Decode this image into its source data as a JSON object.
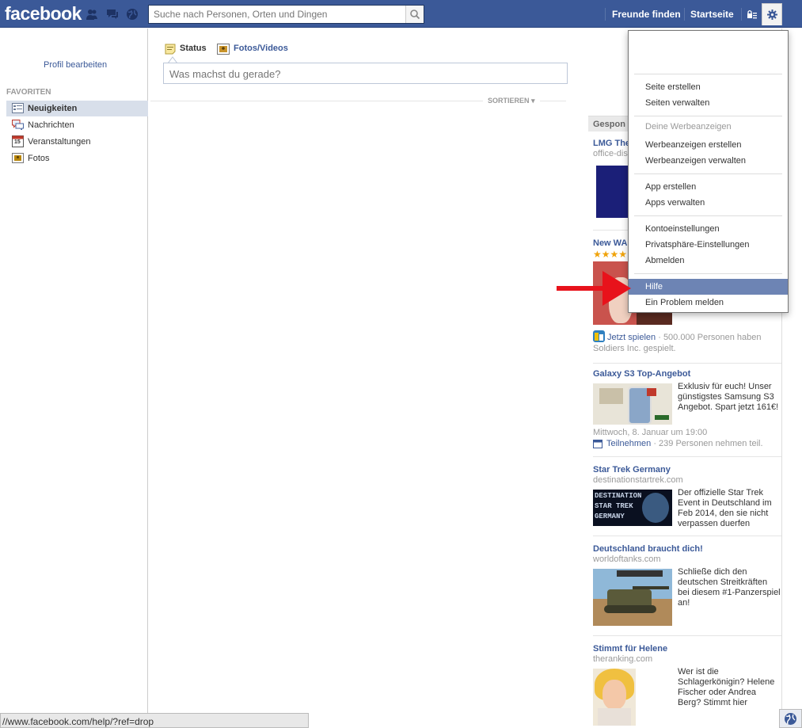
{
  "topbar": {
    "logo": "facebook",
    "search_placeholder": "Suche nach Personen, Orten und Dingen",
    "find_friends": "Freunde finden",
    "home": "Startseite"
  },
  "leftnav": {
    "profile_edit": "Profil bearbeiten",
    "favorites_header": "FAVORITEN",
    "items": [
      {
        "label": "Neuigkeiten",
        "icon": "news-feed-icon"
      },
      {
        "label": "Nachrichten",
        "icon": "messages-icon"
      },
      {
        "label": "Veranstaltungen",
        "icon": "calendar-icon",
        "badge": "15"
      },
      {
        "label": "Fotos",
        "icon": "photos-icon"
      }
    ]
  },
  "composer": {
    "tab_status": "Status",
    "tab_photos": "Fotos/Videos",
    "placeholder": "Was machst du gerade?",
    "sort_label": "SORTIEREN"
  },
  "dropdown": {
    "items": [
      {
        "label": "Seite erstellen"
      },
      {
        "label": "Seiten verwalten"
      },
      {
        "label": "Deine Werbeanzeigen"
      },
      {
        "label": "Werbeanzeigen erstellen"
      },
      {
        "label": "Werbeanzeigen verwalten"
      },
      {
        "label": "App erstellen"
      },
      {
        "label": "Apps verwalten"
      },
      {
        "label": "Kontoeinstellungen"
      },
      {
        "label": "Privatsphäre-Einstellungen"
      },
      {
        "label": "Abmelden"
      },
      {
        "label": "Hilfe"
      },
      {
        "label": "Ein Problem melden"
      }
    ]
  },
  "rightcol": {
    "sponsored": "Gespon",
    "ads": [
      {
        "title": "LMG The",
        "domain": "office-dis"
      },
      {
        "title": "New WA",
        "rating": "★★★★",
        "cta": "Jetzt spielen",
        "meta": "· 500.000 Personen haben Soldiers Inc. gespielt."
      },
      {
        "title": "Galaxy S3 Top-Angebot",
        "body": "Exklusiv für euch! Unser günstigstes Samsung S3 Angebot. Spart jetzt 161€!",
        "date": "Mittwoch, 8. Januar um 19:00",
        "cta": "Teilnehmen",
        "meta": "· 239 Personen nehmen teil."
      },
      {
        "title": "Star Trek Germany",
        "domain": "destinationstartrek.com",
        "body": "Der offizielle Star Trek Event in Deutschland im Feb 2014, den sie nicht verpassen duerfen",
        "image_text": "DESTINATION STAR TREK GERMANY"
      },
      {
        "title": "Deutschland braucht dich!",
        "domain": "worldoftanks.com",
        "body": "Schließe dich den deutschen Streitkräften bei diesem #1-Panzerspiel an!"
      },
      {
        "title": "Stimmt für Helene",
        "domain": "theranking.com",
        "body": "Wer ist die Schlagerkönigin? Helene Fischer oder Andrea Berg? Stimmt hier"
      }
    ]
  },
  "statusbar": {
    "url": "//www.facebook.com/help/?ref=drop"
  },
  "colors": {
    "brand": "#3b5998",
    "highlight": "#6d84b4",
    "arrow": "#e8121b"
  }
}
